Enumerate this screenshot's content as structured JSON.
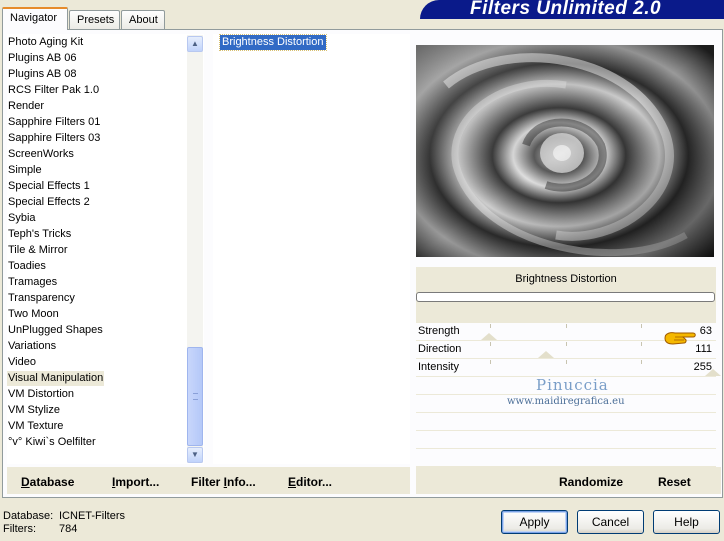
{
  "header": {
    "title": "Filters Unlimited 2.0"
  },
  "tabs": [
    {
      "label": "Navigator",
      "active": true
    },
    {
      "label": "Presets",
      "active": false
    },
    {
      "label": "About",
      "active": false
    }
  ],
  "categories": {
    "items": [
      "Photo Aging Kit",
      "Plugins AB 06",
      "Plugins AB 08",
      "RCS Filter Pak 1.0",
      "Render",
      "Sapphire Filters 01",
      "Sapphire Filters 03",
      "ScreenWorks",
      "Simple",
      "Special Effects 1",
      "Special Effects 2",
      "Sybia",
      "Teph's Tricks",
      "Tile & Mirror",
      "Toadies",
      "Tramages",
      "Transparency",
      "Two Moon",
      "UnPlugged Shapes",
      "Variations",
      "Video",
      "Visual Manipulation",
      "VM Distortion",
      "VM Stylize",
      "VM Texture",
      "°v° Kiwi`s Oelfilter"
    ],
    "selected": "Visual Manipulation"
  },
  "filters": {
    "items": [
      "Brightness Distortion"
    ],
    "selected": "Brightness Distortion"
  },
  "preview": {
    "filter_name": "Brightness Distortion"
  },
  "parameters": [
    {
      "label": "Strength",
      "value": 63
    },
    {
      "label": "Direction",
      "value": 111
    },
    {
      "label": "Intensity",
      "value": 255
    }
  ],
  "watermark": {
    "line1": "Pinuccia",
    "line2": "www.maidiregrafica.eu"
  },
  "bottom_links": {
    "database": "Database",
    "import": "Import...",
    "filter_info": "Filter Info...",
    "editor": "Editor...",
    "randomize": "Randomize",
    "reset": "Reset"
  },
  "status": {
    "database_label": "Database:",
    "database_value": "ICNET-Filters",
    "filters_label": "Filters:",
    "filters_value": "784"
  },
  "dialog_buttons": {
    "apply": "Apply",
    "cancel": "Cancel",
    "help": "Help"
  },
  "colors": {
    "banner": "#0a1a8a",
    "selection": "#316ac5",
    "face": "#ece9d8"
  }
}
